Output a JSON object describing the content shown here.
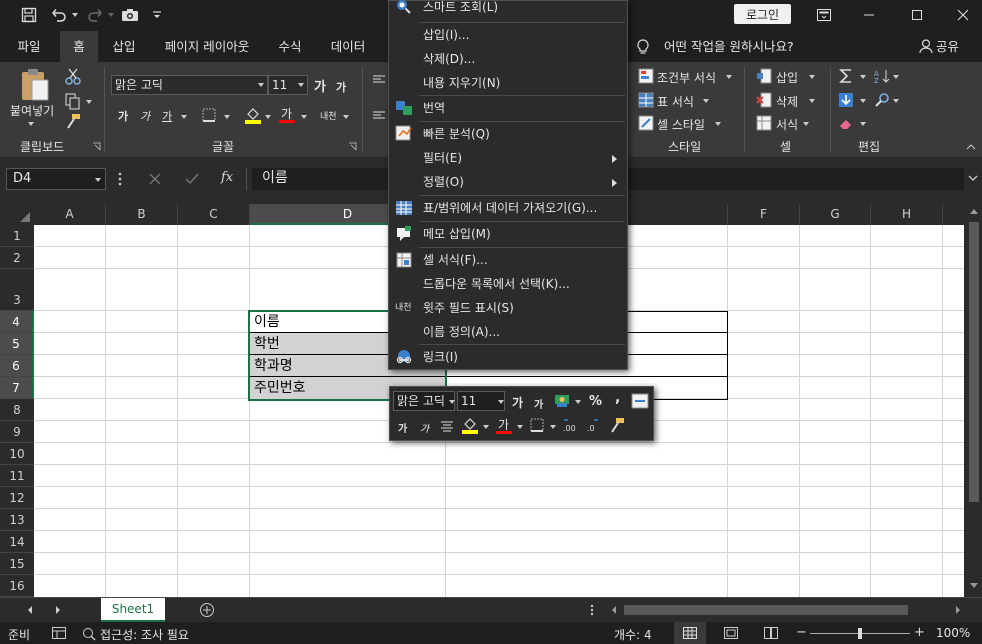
{
  "titlebar": {
    "login_label": "로그인",
    "icons": [
      "save-icon",
      "undo-icon",
      "redo-icon",
      "camera-icon",
      "customize-icon",
      "ribbon-display-icon",
      "minimize-icon",
      "maximize-icon",
      "close-icon"
    ]
  },
  "tabs": [
    "파일",
    "홈",
    "삽입",
    "페이지 레이아웃",
    "수식",
    "데이터"
  ],
  "active_tab": "홈",
  "tell_me": "어떤 작업을 원하시나요?",
  "share_label": "공유",
  "ribbon": {
    "clipboard": {
      "paste_label": "붙여넣기",
      "group_label": "클립보드"
    },
    "font": {
      "font_name": "맑은 고딕",
      "font_size": "11",
      "group_label": "글꼴",
      "grow": "가",
      "shrink": "가",
      "bold": "가",
      "italic": "가",
      "underline": "가",
      "font_color_glyph": "가",
      "phonetic": "내천"
    },
    "styles": {
      "conditional": "조건부 서식",
      "table": "표 서식",
      "cell_style": "셀 스타일",
      "group_label": "스타일"
    },
    "cells": {
      "insert": "삽입",
      "delete": "삭제",
      "format": "서식",
      "group_label": "셀"
    },
    "editing": {
      "group_label": "편집"
    }
  },
  "formula_bar": {
    "name_box": "D4",
    "value": "이름"
  },
  "columns": [
    "A",
    "B",
    "C",
    "D",
    "E",
    "F",
    "G",
    "H"
  ],
  "rows": [
    "1",
    "2",
    "3",
    "4",
    "5",
    "6",
    "7",
    "8",
    "9",
    "10",
    "11",
    "12",
    "13",
    "14",
    "15",
    "16"
  ],
  "cells": [
    {
      "ref": "D4",
      "value": "이름"
    },
    {
      "ref": "D5",
      "value": "학번"
    },
    {
      "ref": "D6",
      "value": "학과명"
    },
    {
      "ref": "D7",
      "value": "주민번호"
    }
  ],
  "context_menu": [
    {
      "label": "스마트 조회(L)",
      "icon": "search-icon"
    },
    {
      "label": "삽입(I)...",
      "icon": ""
    },
    {
      "label": "삭제(D)...",
      "icon": ""
    },
    {
      "label": "내용 지우기(N)",
      "icon": ""
    },
    {
      "label": "번역",
      "icon": "translate-icon"
    },
    {
      "label": "빠른 분석(Q)",
      "icon": "quick-analysis-icon"
    },
    {
      "label": "필터(E)",
      "icon": "",
      "submenu": true
    },
    {
      "label": "정렬(O)",
      "icon": "",
      "submenu": true
    },
    {
      "label": "표/범위에서 데이터 가져오기(G)...",
      "icon": "table-icon"
    },
    {
      "label": "메모 삽입(M)",
      "icon": "comment-icon"
    },
    {
      "label": "셀 서식(F)...",
      "icon": "format-cells-icon"
    },
    {
      "label": "드롭다운 목록에서 선택(K)...",
      "icon": ""
    },
    {
      "label": "윗주 필드 표시(S)",
      "icon": "phonetic-icon"
    },
    {
      "label": "이름 정의(A)...",
      "icon": ""
    },
    {
      "label": "링크(I)",
      "icon": "link-icon"
    }
  ],
  "mini_toolbar": {
    "font_name": "맑은 고딕",
    "font_size": "11",
    "percent": "%",
    "comma": ",",
    "grow": "가",
    "shrink": "가",
    "bold": "가",
    "italic": "가",
    "font_color_glyph": "가"
  },
  "sheet_tab": "Sheet1",
  "status": {
    "ready": "준비",
    "accessibility": "접근성: 조사 필요",
    "count": "개수: 4",
    "zoom": "100%"
  },
  "colors": {
    "accent": "#1e7145",
    "ribbon_bg": "#3a3a3a",
    "title_bg": "#1f1f1f"
  }
}
